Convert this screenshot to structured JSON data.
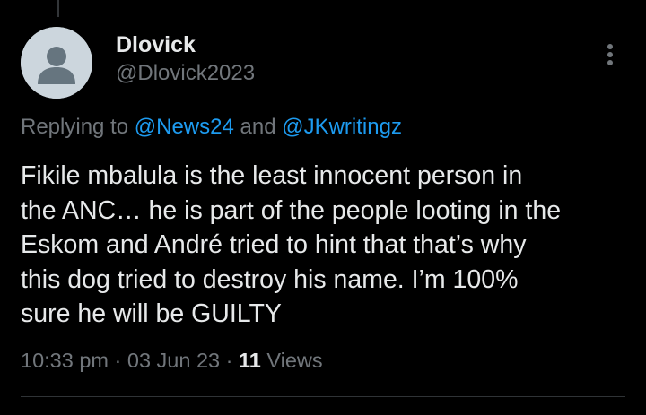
{
  "author": {
    "display_name": "Dlovick",
    "handle": "@Dlovick2023",
    "avatar_icon": "default-person-avatar-icon"
  },
  "reply": {
    "prefix": "Replying to ",
    "mention_1": "@News24",
    "conjunction": " and ",
    "mention_2": "@JKwritingz"
  },
  "tweet": {
    "text": "Fikile mbalula is the least innocent person in\nthe ANC… he is part of the people looting in the\nEskom and André tried to hint that that’s why\nthis dog tried to destroy his name. I’m 100%\nsure he will be GUILTY"
  },
  "meta": {
    "time": "10:33 pm",
    "separator_1": " · ",
    "date": "03 Jun 23",
    "separator_2": " · ",
    "views_count": "11",
    "views_label": " Views"
  },
  "menu": {
    "icon": "more-vertical-icon"
  },
  "colors": {
    "background": "#000000",
    "text_primary": "#e7e9ea",
    "text_secondary": "#71767b",
    "link": "#1d9bf0",
    "divider": "#2f3336"
  }
}
